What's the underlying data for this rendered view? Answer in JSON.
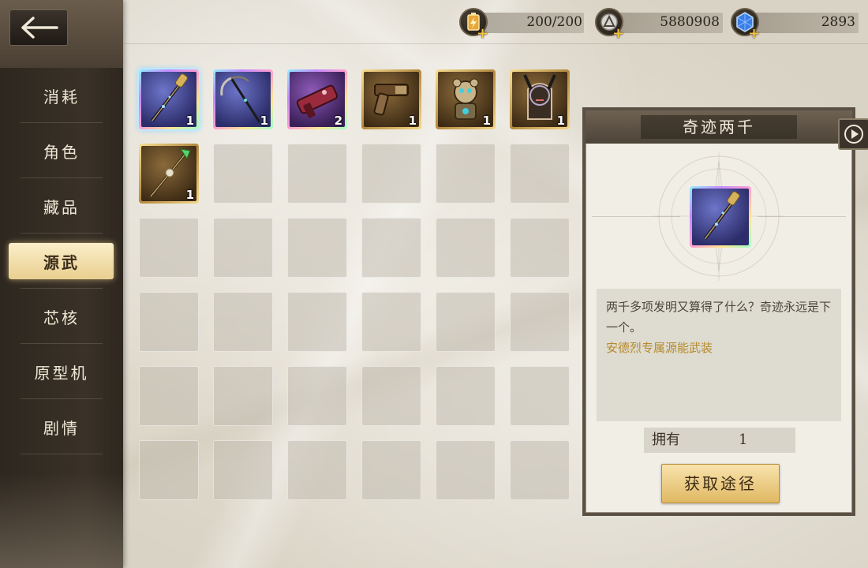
{
  "back": {
    "icon": "back-arrow-icon"
  },
  "sidebar": {
    "items": [
      {
        "label": "消耗",
        "active": false
      },
      {
        "label": "角色",
        "active": false
      },
      {
        "label": "藏品",
        "active": false
      },
      {
        "label": "源武",
        "active": true
      },
      {
        "label": "芯核",
        "active": false
      },
      {
        "label": "原型机",
        "active": false
      },
      {
        "label": "剧情",
        "active": false
      }
    ]
  },
  "currencies": [
    {
      "icon": "stamina-battery-icon",
      "value": "200/200"
    },
    {
      "icon": "silver-coin-icon",
      "value": "5880908"
    },
    {
      "icon": "blue-crystal-icon",
      "value": "2893"
    }
  ],
  "inventory": {
    "items": [
      {
        "icon": "staff-icon",
        "count": "1",
        "rarity": "rainbow"
      },
      {
        "icon": "scythe-icon",
        "count": "1",
        "rarity": "rainbow"
      },
      {
        "icon": "cannon-icon",
        "count": "2",
        "rarity": "rainbow"
      },
      {
        "icon": "pistol-icon",
        "count": "1",
        "rarity": "gold"
      },
      {
        "icon": "bear-robot-icon",
        "count": "1",
        "rarity": "gold"
      },
      {
        "icon": "horned-mask-icon",
        "count": "1",
        "rarity": "gold"
      },
      {
        "icon": "spear-icon",
        "count": "1",
        "rarity": "gold"
      }
    ],
    "empty_slots": 29
  },
  "detail": {
    "title": "奇迹两千",
    "icon": "staff-icon",
    "description": "两千多项发明又算得了什么？奇迹永远是下一个。",
    "subtitle": "安德烈专属源能武装",
    "owned_label": "拥有",
    "owned_value": "1",
    "obtain_label": "获取途径",
    "play_icon": "play-icon"
  },
  "colors": {
    "accent_gold": "#e0b862",
    "sidebar_bg": "#3a3228",
    "desc_highlight": "#b58a2a"
  }
}
